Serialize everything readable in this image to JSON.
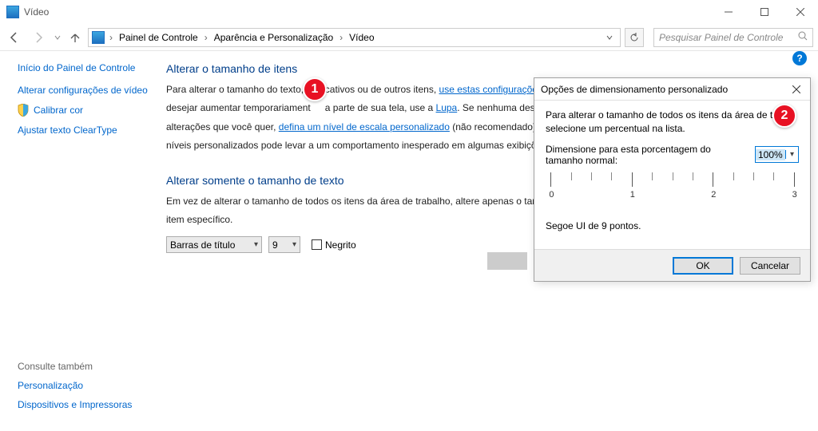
{
  "window": {
    "title": "Vídeo"
  },
  "breadcrumbs": {
    "root": "Painel de Controle",
    "mid": "Aparência e Personalização",
    "leaf": "Vídeo"
  },
  "search": {
    "placeholder": "Pesquisar Painel de Controle"
  },
  "sidebar": {
    "home": "Início do Painel de Controle",
    "link1": "Alterar configurações de vídeo",
    "link2": "Calibrar cor",
    "link3": "Ajustar texto ClearType",
    "see_also": "Consulte também",
    "personalization": "Personalização",
    "devices": "Dispositivos e Impressoras"
  },
  "main": {
    "hdr1": "Alterar o tamanho de itens",
    "p1a": "Para alterar o tamanho do texto, ",
    "p1b": "licativos ou de outros itens, ",
    "link1": "use estas configurações de ex",
    "p2a": "desejar aumentar temporariament",
    "p2b": "a parte de sua tela, use a ",
    "link2": "Lupa",
    "p2c": ". Se nenhuma dessas opçõ",
    "p3a": "alterações que você quer, ",
    "link3": "defina um nível de escala personalizado",
    "p3b": " (não recomendado). A config",
    "p4": "níveis personalizados pode levar a um comportamento inesperado em algumas exibições.",
    "hdr2": "Alterar somente o tamanho de texto",
    "p5": "Em vez de alterar o tamanho de todos os itens da área de trabalho, altere apenas o tamanho do t",
    "p6": "item específico.",
    "select1": "Barras de título",
    "select2": "9",
    "bold": "Negrito"
  },
  "dialog": {
    "title": "Opções de dimensionamento personalizado",
    "p1": "Para alterar o tamanho de todos os itens da área de traba",
    "p1b": "selecione um percentual na lista.",
    "label": "Dimensione para esta porcentagem do tamanho normal:",
    "value": "100%",
    "sample": "Segoe UI de 9 pontos.",
    "ok": "OK",
    "cancel": "Cancelar",
    "ruler": {
      "labels": [
        "0",
        "1",
        "2",
        "3"
      ]
    }
  },
  "callouts": {
    "c1": "1",
    "c2": "2"
  }
}
